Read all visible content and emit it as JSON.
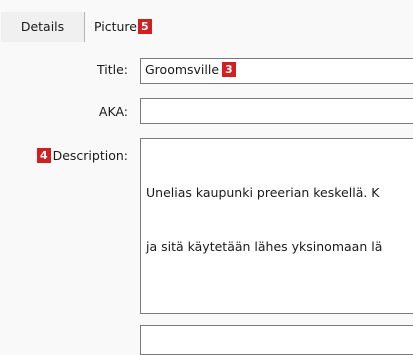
{
  "tabs": [
    {
      "label": "Details",
      "selected": true
    },
    {
      "label": "Picture",
      "badge": "5",
      "selected": false
    }
  ],
  "form": {
    "title": {
      "label": "Title:",
      "value": "Groomsville",
      "badge": "3"
    },
    "aka": {
      "label": "AKA:",
      "value": ""
    },
    "description": {
      "label": "Description:",
      "badge": "4",
      "line1": "Unelias kaupunki preerian keskellä. K",
      "line2": "ja sitä käytetään lähes yksinomaan lä"
    }
  },
  "colors": {
    "badge": "#d21f1f",
    "background": "#f9f9f9",
    "tab_selected": "#f0f0f0",
    "field_border": "#7a7a7a"
  }
}
